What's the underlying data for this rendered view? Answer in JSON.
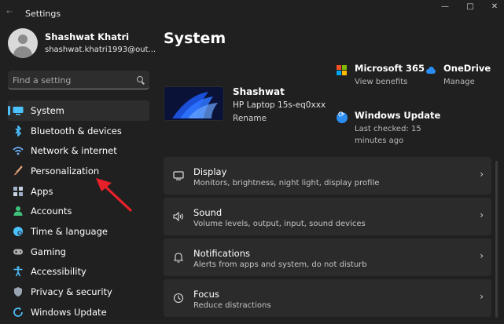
{
  "window": {
    "title": "Settings",
    "back_glyph": "←",
    "controls": {
      "minimize": "—",
      "maximize": "□",
      "close": "✕"
    }
  },
  "profile": {
    "name": "Shashwat Khatri",
    "email": "shashwat.khatri1993@out..."
  },
  "search": {
    "placeholder": "Find a setting",
    "icon": "search-icon"
  },
  "sidebar": {
    "active": "System",
    "items": [
      {
        "label": "System",
        "icon": "monitor-icon",
        "color": "#4cc2ff"
      },
      {
        "label": "Bluetooth & devices",
        "icon": "bluetooth-icon",
        "color": "#4cc2ff"
      },
      {
        "label": "Network & internet",
        "icon": "wifi-icon",
        "color": "#6fb7ff"
      },
      {
        "label": "Personalization",
        "icon": "brush-icon",
        "color": "#e8a87c"
      },
      {
        "label": "Apps",
        "icon": "apps-icon",
        "color": "#9fb0c8"
      },
      {
        "label": "Accounts",
        "icon": "person-icon",
        "color": "#3fc17a"
      },
      {
        "label": "Time & language",
        "icon": "globe-icon",
        "color": "#4cc2ff"
      },
      {
        "label": "Gaming",
        "icon": "gamepad-icon",
        "color": "#b0b0b0"
      },
      {
        "label": "Accessibility",
        "icon": "accessibility-icon",
        "color": "#4cc2ff"
      },
      {
        "label": "Privacy & security",
        "icon": "shield-icon",
        "color": "#9aa4b2"
      },
      {
        "label": "Windows Update",
        "icon": "update-icon",
        "color": "#4cc2ff"
      }
    ]
  },
  "main": {
    "title": "System",
    "device": {
      "name": "Shashwat",
      "model": "HP Laptop 15s-eq0xxx",
      "rename": "Rename"
    },
    "quick_links": [
      {
        "title": "Microsoft 365",
        "sub": "View benefits",
        "icon": "microsoft-365-icon"
      },
      {
        "title": "OneDrive",
        "sub": "Manage",
        "icon": "onedrive-icon"
      },
      {
        "title": "Windows Update",
        "sub": "Last checked: 15 minutes ago",
        "icon": "windows-update-icon"
      }
    ],
    "cards": [
      {
        "title": "Display",
        "sub": "Monitors, brightness, night light, display profile",
        "icon": "display-icon"
      },
      {
        "title": "Sound",
        "sub": "Volume levels, output, input, sound devices",
        "icon": "speaker-icon"
      },
      {
        "title": "Notifications",
        "sub": "Alerts from apps and system, do not disturb",
        "icon": "bell-icon"
      },
      {
        "title": "Focus",
        "sub": "Reduce distractions",
        "icon": "focus-icon"
      }
    ],
    "chevron": "›"
  },
  "colors": {
    "background": "#202020",
    "card": "#2b2b2b",
    "accent": "#4cc2ff",
    "annotation_arrow": "#e8202a"
  }
}
